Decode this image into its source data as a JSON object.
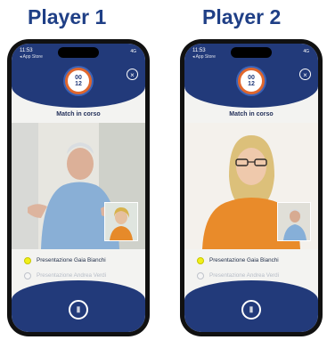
{
  "labels": {
    "player1": "Player 1",
    "player2": "Player 2"
  },
  "screens": [
    {
      "time": "11:53",
      "app_back": "◂ App Store",
      "signal": "4G",
      "timer_minutes": "00",
      "timer_seconds": "12",
      "close_icon": "×",
      "match_label": "Match in corso",
      "entries": [
        {
          "label": "Presentazione Gaia Bianchi",
          "state": "active"
        },
        {
          "label": "Presentazione Andrea Verdi",
          "state": "inactive"
        }
      ],
      "pause_icon": "Ⅱ"
    },
    {
      "time": "11:53",
      "app_back": "◂ App Store",
      "signal": "4G",
      "timer_minutes": "00",
      "timer_seconds": "12",
      "close_icon": "×",
      "match_label": "Match in corso",
      "entries": [
        {
          "label": "Presentazione Gaia Bianchi",
          "state": "active"
        },
        {
          "label": "Presentazione Andrea Verdi",
          "state": "inactive"
        }
      ],
      "pause_icon": "Ⅱ"
    }
  ]
}
